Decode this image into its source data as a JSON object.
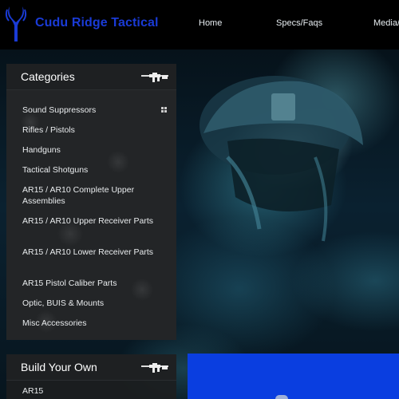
{
  "header": {
    "brand": "Cudu Ridge Tactical",
    "nav": [
      "Home",
      "Specs/Faqs",
      "Media/"
    ]
  },
  "categories": {
    "title": "Categories",
    "items": [
      "Sound Suppressors",
      "Rifles / Pistols",
      "Handguns",
      "Tactical Shotguns",
      "AR15 / AR10 Complete Upper Assemblies",
      "AR15 / AR10 Upper Receiver Parts",
      "AR15 / AR10 Lower Receiver Parts",
      "AR15 Pistol Caliber Parts",
      "Optic, BUIS & Mounts",
      "Misc Accessories"
    ]
  },
  "build": {
    "title": "Build Your Own",
    "first_item": "AR15"
  },
  "colors": {
    "brand": "#1a3bd6",
    "accent_blue": "#0a3ee0",
    "panel": "#232527"
  },
  "icons": [
    "kudu-logo-icon",
    "rifle-icon",
    "grid-icon"
  ]
}
